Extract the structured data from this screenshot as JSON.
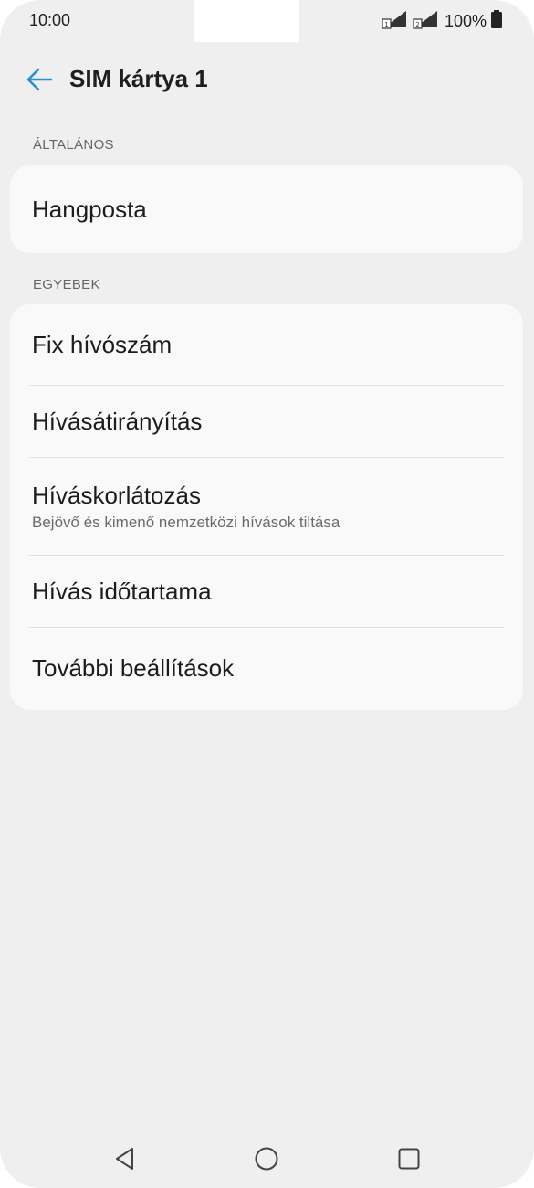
{
  "status_bar": {
    "time": "10:00",
    "battery_percent": "100%",
    "icons": [
      "sim1-signal-icon",
      "sim2-signal-icon",
      "battery-icon"
    ]
  },
  "toolbar": {
    "back_icon": "arrow-left-icon",
    "title": "SIM kártya 1"
  },
  "sections": [
    {
      "header": "ÁLTALÁNOS",
      "items": [
        {
          "title": "Hangposta"
        }
      ]
    },
    {
      "header": "EGYEBEK",
      "items": [
        {
          "title": "Fix hívószám"
        },
        {
          "title": "Hívásátirányítás"
        },
        {
          "title": "Híváskorlátozás",
          "subtitle": "Bejövő és kimenő nemzetközi hívások tiltása"
        },
        {
          "title": "Hívás időtartama"
        },
        {
          "title": "További beállítások"
        }
      ]
    }
  ],
  "nav_bar": {
    "icons": [
      "back-triangle-icon",
      "home-circle-icon",
      "recents-square-icon"
    ]
  },
  "colors": {
    "accent": "#2a8fd6",
    "background": "#efefef",
    "card": "#f9f9f9"
  }
}
